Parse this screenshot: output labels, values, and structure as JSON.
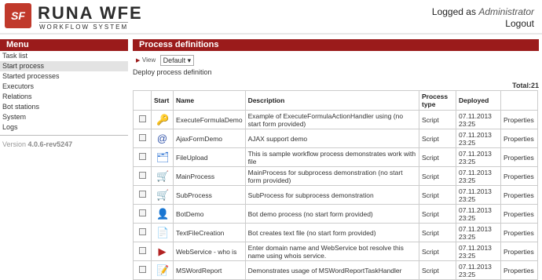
{
  "logo": {
    "mark": "SF",
    "title": "RUNA WFE",
    "subtitle": "WORKFLOW SYSTEM"
  },
  "login": {
    "prefix": "Logged as",
    "user": "Administrator",
    "logout": "Logout"
  },
  "sidebar": {
    "title": "Menu",
    "items": [
      {
        "label": "Task list",
        "active": false
      },
      {
        "label": "Start process",
        "active": true
      },
      {
        "label": "Started processes",
        "active": false
      },
      {
        "label": "Executors",
        "active": false
      },
      {
        "label": "Relations",
        "active": false
      },
      {
        "label": "Bot stations",
        "active": false
      },
      {
        "label": "System",
        "active": false
      },
      {
        "label": "Logs",
        "active": false
      }
    ],
    "version_label": "Version",
    "version": "4.0.6-rev5247"
  },
  "main": {
    "title": "Process definitions",
    "view_label": "View",
    "view_value": "Default",
    "deploy_link": "Deploy process definition",
    "total": "Total:21",
    "columns": [
      "Start",
      "Name",
      "Description",
      "Process type",
      "Deployed"
    ],
    "rows": [
      {
        "icon": "key-icon",
        "glyph": "🔑",
        "name": "ExecuteFormulaDemo",
        "description": "Example of ExecuteFormulaActionHandler using (no start form provided)",
        "type": "Script",
        "date": "07.11.2013",
        "time": "23:25",
        "action": "Properties"
      },
      {
        "icon": "at-sign-icon",
        "glyph": "@",
        "name": "AjaxFormDemo",
        "description": "AJAX support demo",
        "type": "Script",
        "date": "07.11.2013",
        "time": "23:25",
        "action": "Properties"
      },
      {
        "icon": "file-upload-icon",
        "glyph": "🗂",
        "name": "FileUpload",
        "description": "This is sample workflow process demonstrates work with file",
        "type": "Script",
        "date": "07.11.2013",
        "time": "23:25",
        "action": "Properties"
      },
      {
        "icon": "shopping-cart-icon",
        "glyph": "🛒",
        "name": "MainProcess",
        "description": "MainProcess for subprocess demonstration (no start form provided)",
        "type": "Script",
        "date": "07.11.2013",
        "time": "23:25",
        "action": "Properties"
      },
      {
        "icon": "cart-plus-icon",
        "glyph": "🛒",
        "name": "SubProcess",
        "description": "SubProcess for subprocess demonstration",
        "type": "Script",
        "date": "07.11.2013",
        "time": "23:25",
        "action": "Properties"
      },
      {
        "icon": "bot-icon",
        "glyph": "👤",
        "name": "BotDemo",
        "description": "Bot demo process (no start form provided)",
        "type": "Script",
        "date": "07.11.2013",
        "time": "23:25",
        "action": "Properties"
      },
      {
        "icon": "text-file-icon",
        "glyph": "📄",
        "name": "TextFileCreation",
        "description": "Bot creates text file (no start form provided)",
        "type": "Script",
        "date": "07.11.2013",
        "time": "23:25",
        "action": "Properties"
      },
      {
        "icon": "play-circle-icon",
        "glyph": "▶",
        "name": "WebService - who is",
        "description": "Enter domain name and WebService bot resolve this name using whois service.",
        "type": "Script",
        "date": "07.11.2013",
        "time": "23:25",
        "action": "Properties"
      },
      {
        "icon": "word-report-icon",
        "glyph": "📝",
        "name": "MSWordReport",
        "description": "Demonstrates usage of MSWordReportTaskHandler",
        "type": "Script",
        "date": "07.11.2013",
        "time": "23:25",
        "action": "Properties"
      }
    ]
  }
}
